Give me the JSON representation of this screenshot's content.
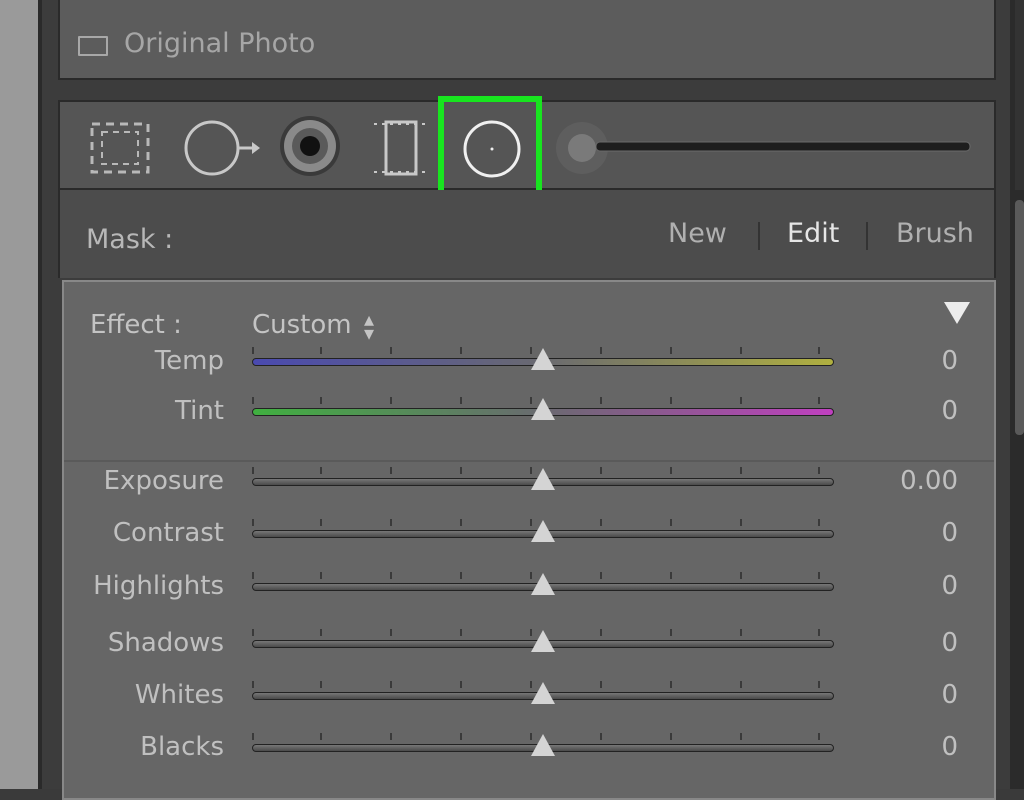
{
  "original_photo": {
    "label": "Original Photo",
    "checked": false
  },
  "tools": [
    {
      "name": "crop-overlay-icon"
    },
    {
      "name": "spot-removal-icon"
    },
    {
      "name": "red-eye-icon"
    },
    {
      "name": "graduated-filter-icon"
    },
    {
      "name": "radial-filter-icon",
      "selected": true
    },
    {
      "name": "adjustment-brush-icon"
    }
  ],
  "mask": {
    "label": "Mask :",
    "options": [
      {
        "label": "New",
        "active": false
      },
      {
        "label": "Edit",
        "active": true
      },
      {
        "label": "Brush",
        "active": false
      }
    ]
  },
  "effect": {
    "label": "Effect :",
    "value": "Custom"
  },
  "sliders_top": [
    {
      "label": "Temp",
      "value": "0",
      "level": 0.5,
      "style": "temp"
    },
    {
      "label": "Tint",
      "value": "0",
      "level": 0.5,
      "style": "tint"
    }
  ],
  "sliders_main": [
    {
      "label": "Exposure",
      "value": "0.00",
      "level": 0.5
    },
    {
      "label": "Contrast",
      "value": "0",
      "level": 0.5
    },
    {
      "label": "Highlights",
      "value": "0",
      "level": 0.5
    },
    {
      "label": "Shadows",
      "value": "0",
      "level": 0.5
    },
    {
      "label": "Whites",
      "value": "0",
      "level": 0.5
    },
    {
      "label": "Blacks",
      "value": "0",
      "level": 0.5
    }
  ],
  "colors": {
    "highlight": "#18e51f"
  }
}
